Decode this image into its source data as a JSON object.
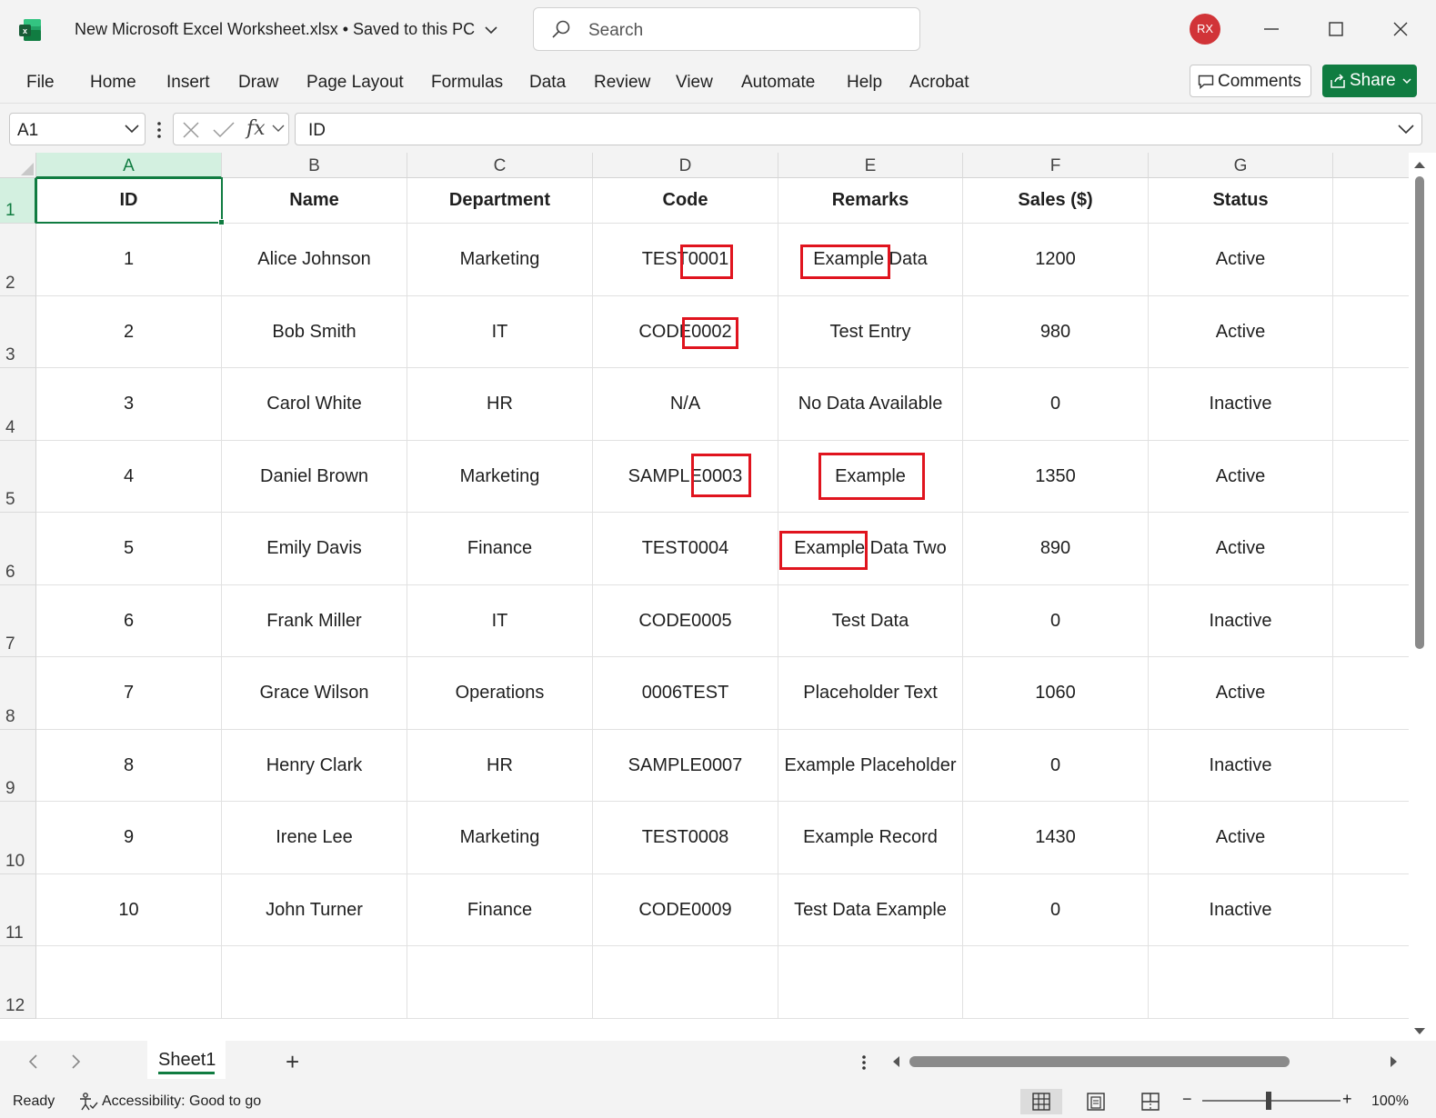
{
  "window": {
    "title": "New Microsoft Excel Worksheet.xlsx • Saved to this PC",
    "search_placeholder": "Search",
    "avatar_initials": "RX"
  },
  "ribbon": {
    "tabs": [
      "File",
      "Home",
      "Insert",
      "Draw",
      "Page Layout",
      "Formulas",
      "Data",
      "Review",
      "View",
      "Automate",
      "Help",
      "Acrobat"
    ],
    "comments_label": "Comments",
    "share_label": "Share"
  },
  "formula_bar": {
    "name_box": "A1",
    "fx_symbol": "fx",
    "content": "ID"
  },
  "grid": {
    "columns": [
      "A",
      "B",
      "C",
      "D",
      "E",
      "F",
      "G"
    ],
    "row_numbers": [
      "1",
      "2",
      "3",
      "4",
      "5",
      "6",
      "7",
      "8",
      "9",
      "10",
      "11",
      "12"
    ],
    "rows": [
      [
        "ID",
        "Name",
        "Department",
        "Code",
        "Remarks",
        "Sales ($)",
        "Status"
      ],
      [
        "1",
        "Alice Johnson",
        "Marketing",
        "TEST0001",
        "Example Data",
        "1200",
        "Active"
      ],
      [
        "2",
        "Bob Smith",
        "IT",
        "CODE0002",
        "Test Entry",
        "980",
        "Active"
      ],
      [
        "3",
        "Carol White",
        "HR",
        "N/A",
        "No Data Available",
        "0",
        "Inactive"
      ],
      [
        "4",
        "Daniel Brown",
        "Marketing",
        "SAMPLE0003",
        "Example",
        "1350",
        "Active"
      ],
      [
        "5",
        "Emily Davis",
        "Finance",
        "TEST0004",
        "Example Data Two",
        "890",
        "Active"
      ],
      [
        "6",
        "Frank Miller",
        "IT",
        "CODE0005",
        "Test Data",
        "0",
        "Inactive"
      ],
      [
        "7",
        "Grace Wilson",
        "Operations",
        "0006TEST",
        "Placeholder Text",
        "1060",
        "Active"
      ],
      [
        "8",
        "Henry Clark",
        "HR",
        "SAMPLE0007",
        "Example Placeholder",
        "0",
        "Inactive"
      ],
      [
        "9",
        "Irene Lee",
        "Marketing",
        "TEST0008",
        "Example Record",
        "1430",
        "Active"
      ],
      [
        "10",
        "John Turner",
        "Finance",
        "CODE0009",
        "Test Data Example",
        "0",
        "Inactive"
      ],
      [
        "",
        "",
        "",
        "",
        "",
        "",
        ""
      ]
    ],
    "selected_cell": "A1"
  },
  "sheets": {
    "tabs": [
      "Sheet1"
    ],
    "add_label": "+"
  },
  "status": {
    "ready": "Ready",
    "accessibility": "Accessibility: Good to go",
    "zoom": "100%"
  },
  "colors": {
    "accent": "#107c41",
    "highlight_box": "#e0141e",
    "avatar": "#d13438"
  }
}
